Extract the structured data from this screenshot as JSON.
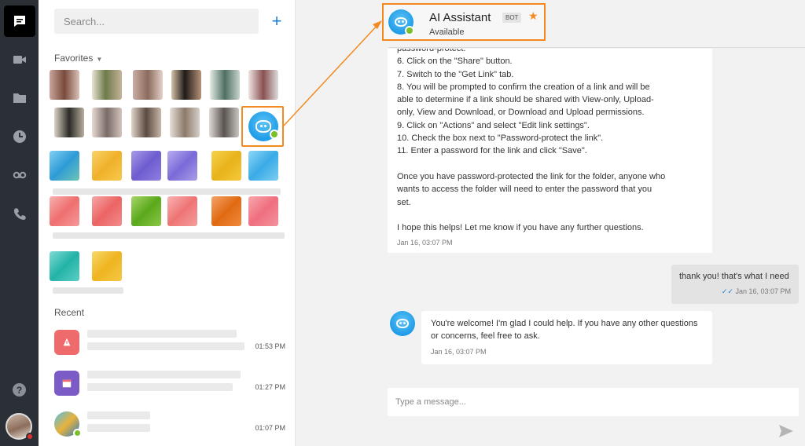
{
  "sidebar": {
    "icons": [
      "chat-icon",
      "video-icon",
      "folder-icon",
      "clock-icon",
      "voicemail-icon",
      "phone-icon"
    ],
    "help_label": "?"
  },
  "contacts": {
    "search_placeholder": "Search...",
    "add_label": "+",
    "favorites_label": "Favorites",
    "recent_label": "Recent",
    "recent_items": [
      {
        "time": "01:53 PM",
        "icon_color": "#ef5b5b"
      },
      {
        "time": "01:27 PM",
        "icon_color": "#7b5cc7"
      },
      {
        "time": "01:07 PM",
        "icon_color": "#1f9ce8"
      }
    ]
  },
  "chat": {
    "header": {
      "name": "AI Assistant",
      "badge": "BOT",
      "status": "Available"
    },
    "messages": [
      {
        "lines": [
          "password-protect.",
          "6. Click on the \"Share\" button.",
          "7. Switch to the \"Get Link\" tab.",
          "8. You will be prompted to confirm the creation of a link and will be",
          "able to determine if a link should be shared with View-only, Upload-",
          "only, View and Download, or Download and Upload permissions.",
          "9. Click on \"Actions\" and select \"Edit link settings\".",
          "10. Check the box next to \"Password-protect the link\".",
          "11. Enter a password for the link and click \"Save\".",
          "",
          "Once you have password-protected the link for the folder, anyone who",
          "wants to access the folder will need to enter the password that you",
          "set.",
          "",
          "I hope this helps! Let me know if you have any further questions."
        ],
        "time": "Jan 16, 03:07 PM"
      },
      {
        "lines": [
          "thank you! that's what I need"
        ],
        "time": "Jan 16, 03:07 PM"
      },
      {
        "lines": [
          "You're welcome! I'm glad I could help. If you have any other questions",
          "or concerns, feel free to ask."
        ],
        "time": "Jan 16, 03:07 PM"
      }
    ],
    "composer_placeholder": "Type a message..."
  },
  "colors": {
    "accent": "#1e7fd6",
    "highlight": "#f28a1f",
    "online": "#7bbf2a",
    "rail": "#2b3036"
  }
}
